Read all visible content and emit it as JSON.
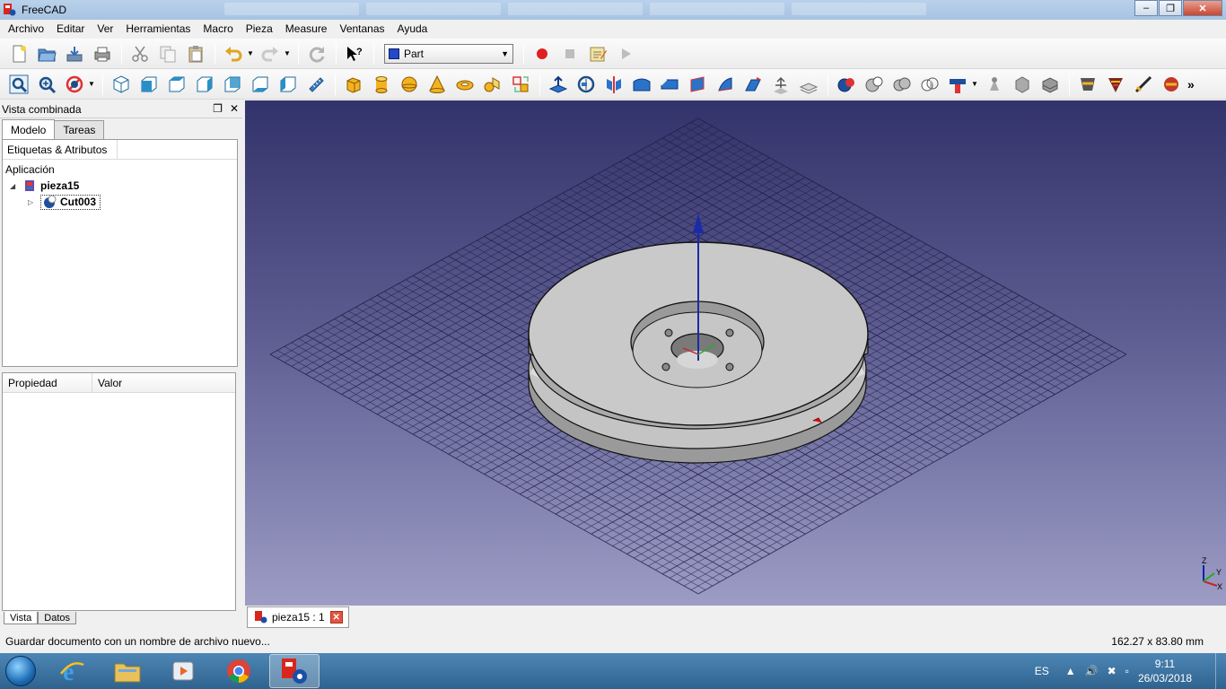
{
  "window": {
    "title": "FreeCAD"
  },
  "menu": [
    "Archivo",
    "Editar",
    "Ver",
    "Herramientas",
    "Macro",
    "Pieza",
    "Measure",
    "Ventanas",
    "Ayuda"
  ],
  "toolbar": {
    "workbench": "Part"
  },
  "combo": {
    "title": "Vista combinada",
    "tabs": [
      "Modelo",
      "Tareas"
    ],
    "tree_header": "Etiquetas & Atributos",
    "tree_root": "Aplicación",
    "document": "pieza15",
    "object": "Cut003",
    "props_columns": [
      "Propiedad",
      "Valor"
    ],
    "bottom_tabs": [
      "Vista",
      "Datos"
    ]
  },
  "doc_tab": {
    "label": "pieza15 : 1"
  },
  "axes": {
    "x": "X",
    "y": "Y",
    "z": "Z"
  },
  "status": {
    "message": "Guardar documento con un nombre de archivo nuevo...",
    "dimensions": "162.27 x 83.80 mm"
  },
  "taskbar": {
    "lang": "ES",
    "time": "9:11",
    "date": "26/03/2018"
  },
  "colors": {
    "view_top": "#33336b",
    "view_bottom": "#9c9cc5",
    "part_face": "#c8c8c8"
  }
}
